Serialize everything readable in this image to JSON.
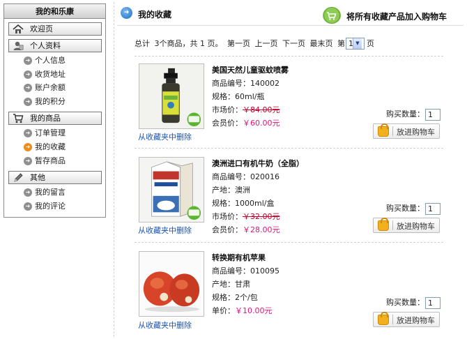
{
  "sidebar": {
    "title": "我的和乐康",
    "sections": [
      {
        "label": "欢迎页",
        "icon": "home-icon",
        "items": []
      },
      {
        "label": "个人资料",
        "icon": "profile-icon",
        "items": [
          "个人信息",
          "收货地址",
          "账户余额",
          "我的积分"
        ]
      },
      {
        "label": "我的商品",
        "icon": "cart-icon",
        "items": [
          "订单管理",
          "我的收藏",
          "暂存商品"
        ]
      },
      {
        "label": "其他",
        "icon": "pencil-icon",
        "items": [
          "我的留言",
          "我的评论"
        ]
      }
    ],
    "active_item": "我的收藏"
  },
  "header": {
    "title": "我的收藏",
    "add_all_label": "将所有收藏产品加入购物车"
  },
  "pager": {
    "total": "总计",
    "summary": "3个商品，共 1 页。",
    "first": "第一页",
    "prev": "上一页",
    "next": "下一页",
    "last": "最末页",
    "page_prefix": "第",
    "page_value": "1",
    "page_suffix": "页"
  },
  "products": [
    {
      "name": "美国天然儿童驱蚊喷雾",
      "lines": [
        {
          "label": "商品编号：",
          "value": "140002"
        },
        {
          "label": "规格：",
          "value": "60ml/瓶"
        }
      ],
      "market_label": "市场价：",
      "market_price": "￥84.00元",
      "member_label": "会员价：",
      "member_price": "￥60.00元",
      "qty_label": "购买数量：",
      "qty": "1",
      "remove_label": "从收藏夹中删除",
      "cart_label": "放进购物车",
      "image": "spray-bottle"
    },
    {
      "name": "澳洲进口有机牛奶（全脂）",
      "lines": [
        {
          "label": "商品编号：",
          "value": "020016"
        },
        {
          "label": "产地：",
          "value": "澳洲"
        },
        {
          "label": "规格：",
          "value": "1000ml/盒"
        }
      ],
      "market_label": "市场价：",
      "market_price": "￥32.00元",
      "member_label": "会员价：",
      "member_price": "￥28.00元",
      "qty_label": "购买数量：",
      "qty": "1",
      "remove_label": "从收藏夹中删除",
      "cart_label": "放进购物车",
      "image": "milk-carton"
    },
    {
      "name": "转换期有机苹果",
      "lines": [
        {
          "label": "商品编号：",
          "value": "010095"
        },
        {
          "label": "产地：",
          "value": "甘肃"
        },
        {
          "label": "规格：",
          "value": "2个/包"
        }
      ],
      "unit_label": "单价：",
      "unit_price": "￥10.00元",
      "qty_label": "购买数量：",
      "qty": "1",
      "remove_label": "从收藏夹中删除",
      "cart_label": "放进购物车",
      "image": "apples"
    }
  ],
  "colors": {
    "link": "#1a55b8",
    "price": "#e4137a",
    "strike": "#c4002a",
    "active_arrow": "#f08a1a"
  }
}
